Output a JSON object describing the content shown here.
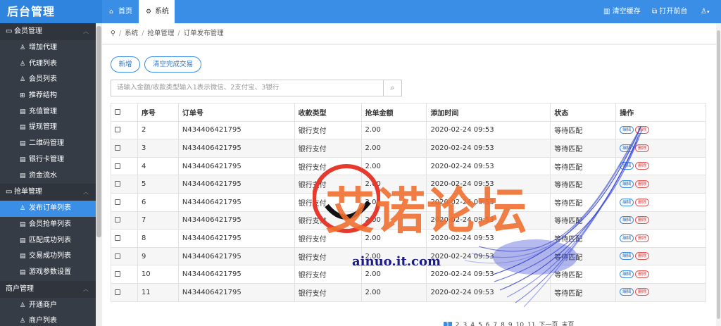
{
  "app": {
    "title": "后台管理"
  },
  "tabs": [
    {
      "label": "首页",
      "icon": "home-icon"
    },
    {
      "label": "系统",
      "icon": "gear-icon"
    }
  ],
  "topbar": {
    "clear_cache": "清空缓存",
    "open_frontend": "打开前台",
    "user_icon": "user-icon"
  },
  "sidebar": {
    "groups": [
      {
        "label": "会员管理",
        "items": [
          "增加代理",
          "代理列表",
          "会员列表",
          "推荐结构",
          "充值管理",
          "提现管理",
          "二维码管理",
          "银行卡管理",
          "资金流水"
        ]
      },
      {
        "label": "抢单管理",
        "items": [
          "发布订单列表",
          "会员抢单列表",
          "匹配成功列表",
          "交易成功列表",
          "游戏参数设置"
        ]
      },
      {
        "label": "商户管理",
        "items": [
          "开通商户",
          "商户列表"
        ]
      }
    ]
  },
  "breadcrumb": [
    "系统",
    "抢单管理",
    "订单发布管理"
  ],
  "toolbar": {
    "add_label": "新增",
    "clear_label": "清空完成交易"
  },
  "search": {
    "placeholder": "请输入金额/收款类型输入1表示微信、2支付宝、3银行"
  },
  "table": {
    "columns": [
      "序号",
      "订单号",
      "收款类型",
      "抢单金额",
      "添加时间",
      "状态",
      "操作"
    ],
    "rows": [
      {
        "no": "2",
        "order": "N434406421795",
        "type": "银行支付",
        "amount": "2.00",
        "time": "2020-02-24 09:53",
        "status": "等待匹配"
      },
      {
        "no": "3",
        "order": "N434406421795",
        "type": "银行支付",
        "amount": "2.00",
        "time": "2020-02-24 09:53",
        "status": "等待匹配"
      },
      {
        "no": "4",
        "order": "N434406421795",
        "type": "银行支付",
        "amount": "2.00",
        "time": "2020-02-24 09:53",
        "status": "等待匹配"
      },
      {
        "no": "5",
        "order": "N434406421795",
        "type": "银行支付",
        "amount": "2.00",
        "time": "2020-02-24 09:53",
        "status": "等待匹配"
      },
      {
        "no": "6",
        "order": "N434406421795",
        "type": "银行支付",
        "amount": "2.00",
        "time": "2020-02-24 09:53",
        "status": "等待匹配"
      },
      {
        "no": "7",
        "order": "N434406421795",
        "type": "银行支付",
        "amount": "2.00",
        "time": "2020-02-24 09:53",
        "status": "等待匹配"
      },
      {
        "no": "8",
        "order": "N434406421795",
        "type": "银行支付",
        "amount": "2.00",
        "time": "2020-02-24 09:53",
        "status": "等待匹配"
      },
      {
        "no": "9",
        "order": "N434406421795",
        "type": "银行支付",
        "amount": "2.00",
        "time": "2020-02-24 09:53",
        "status": "等待匹配"
      },
      {
        "no": "10",
        "order": "N434406421795",
        "type": "银行支付",
        "amount": "2.00",
        "time": "2020-02-24 09:53",
        "status": "等待匹配"
      },
      {
        "no": "11",
        "order": "N434406421795",
        "type": "银行支付",
        "amount": "2.00",
        "time": "2020-02-24 09:53",
        "status": "等待匹配"
      }
    ],
    "edit_label": "编辑",
    "delete_label": "删除"
  },
  "pager": {
    "pages": [
      "1",
      "2",
      "3",
      "4",
      "5",
      "6",
      "7",
      "8",
      "9",
      "10",
      "11"
    ],
    "current": "1",
    "next": "下一页",
    "last": "末页"
  },
  "watermark": {
    "text": "艾诺论坛",
    "url": "ainuo.it.com"
  },
  "colors": {
    "primary": "#3a8ee6",
    "sidebar": "#363c46",
    "danger": "#e05555"
  }
}
